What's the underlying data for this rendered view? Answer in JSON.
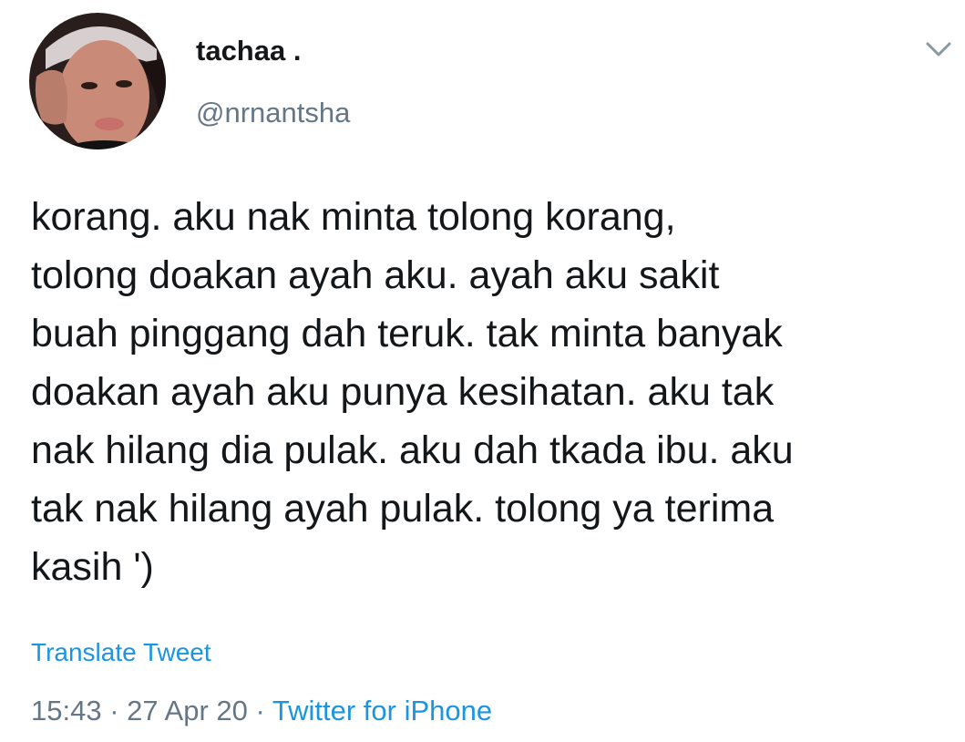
{
  "tweet": {
    "display_name": "tachaa .",
    "handle": "@nrnantsha",
    "body_lines": [
      "korang. aku nak minta tolong korang,",
      "tolong doakan ayah aku. ayah aku sakit",
      "buah pinggang dah teruk. tak minta banyak",
      "doakan ayah aku punya kesihatan. aku tak",
      "nak hilang dia pulak. aku dah tkada ibu. aku",
      "tak nak hilang ayah pulak. tolong ya terima",
      "kasih ')"
    ],
    "translate_label": "Translate Tweet",
    "time": "15:43",
    "separator": "·",
    "date": "27 Apr 20",
    "source": "Twitter for iPhone"
  },
  "icons": {
    "caret": "chevron-down-icon",
    "avatar": "avatar"
  },
  "colors": {
    "text_primary": "#14171a",
    "text_secondary": "#657786",
    "link": "#1b95e0",
    "caret": "#8899a6"
  }
}
